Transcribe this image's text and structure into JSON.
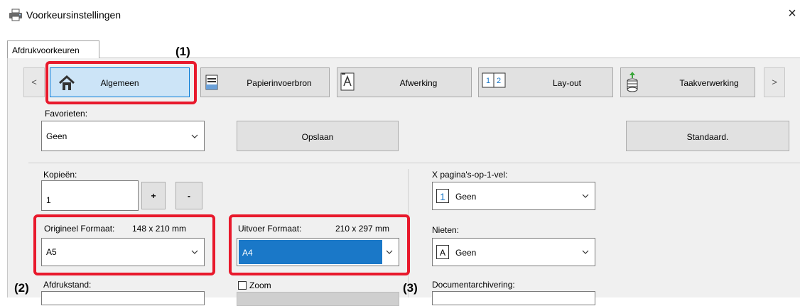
{
  "window": {
    "title": "Voorkeursinstellingen",
    "close_glyph": "×"
  },
  "tab": {
    "label": "Afdrukvoorkeuren"
  },
  "nav": {
    "prev": "<",
    "next": ">",
    "items": [
      {
        "label": "Algemeen",
        "icon": "home-icon",
        "selected": true
      },
      {
        "label": "Papierinvoerbron",
        "icon": "paper-tray-icon",
        "selected": false
      },
      {
        "label": "Afwerking",
        "icon": "finishing-icon",
        "selected": false
      },
      {
        "label": "Lay-out",
        "icon": "layout-icon",
        "selected": false
      },
      {
        "label": "Taakverwerking",
        "icon": "job-handling-icon",
        "selected": false
      }
    ]
  },
  "favorites": {
    "label": "Favorieten:",
    "value": "Geen",
    "save_label": "Opslaan",
    "default_label": "Standaard."
  },
  "copies": {
    "label": "Kopieën:",
    "value": "1",
    "plus": "+",
    "minus": "-"
  },
  "original_size": {
    "label": "Origineel Formaat:",
    "dimensions": "148 x 210 mm",
    "value": "A5"
  },
  "output_size": {
    "label": "Uitvoer Formaat:",
    "dimensions": "210 x 297 mm",
    "value": "A4"
  },
  "pages_per_sheet": {
    "label": "X pagina's-op-1-vel:",
    "value": "Geen",
    "icon_text": "1"
  },
  "staple": {
    "label": "Nieten:",
    "value": "Geen",
    "icon_text": "A"
  },
  "orientation": {
    "label": "Afdrukstand:"
  },
  "zoom": {
    "label": "Zoom"
  },
  "document_archiving": {
    "label": "Documentarchivering:"
  },
  "callouts": {
    "c1": "(1)",
    "c2": "(2)",
    "c3": "(3)"
  },
  "colors": {
    "highlight": "#e8192c",
    "selection": "#1a78c8",
    "selected_tab": "#cce4f7"
  }
}
